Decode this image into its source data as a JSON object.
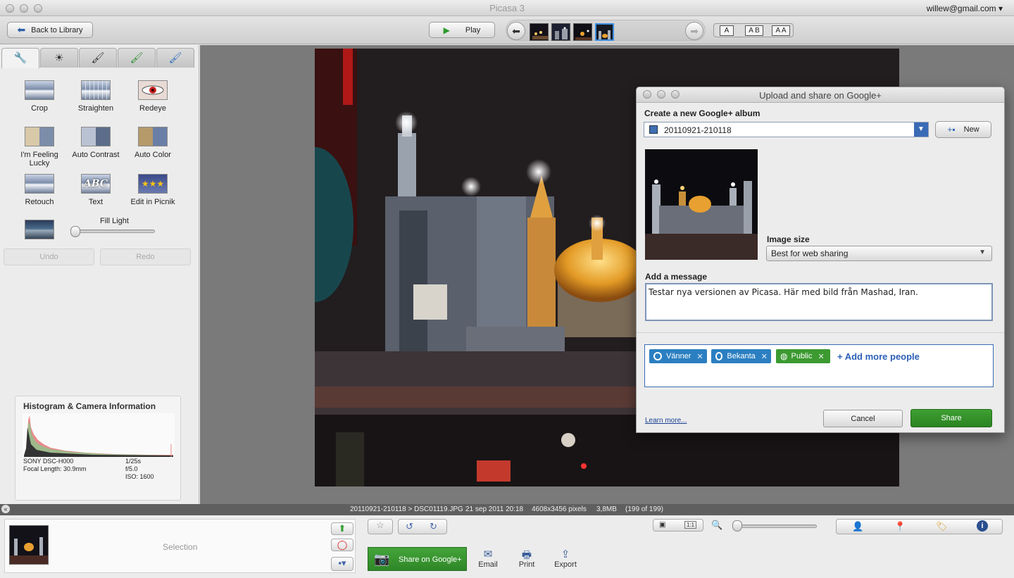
{
  "window": {
    "title": "Picasa 3",
    "account": "willew@gmail.com"
  },
  "toolbar": {
    "back_label": "Back to Library",
    "play_label": "Play",
    "captions": [
      "A",
      "A B",
      "A A"
    ]
  },
  "edit_panel": {
    "tools": [
      {
        "label": "Crop"
      },
      {
        "label": "Straighten"
      },
      {
        "label": "Redeye"
      },
      {
        "label": "I'm Feeling Lucky"
      },
      {
        "label": "Auto Contrast"
      },
      {
        "label": "Auto Color"
      },
      {
        "label": "Retouch"
      },
      {
        "label": "Text"
      },
      {
        "label": "Edit in Picnik"
      }
    ],
    "fill_light_label": "Fill Light",
    "fill_light_value": 0,
    "undo_label": "Undo",
    "redo_label": "Redo"
  },
  "histogram": {
    "title": "Histogram & Camera Information",
    "camera": "SONY DSC-H000",
    "focal_length": "Focal Length: 30.9mm",
    "shutter": "1/25s",
    "aperture": "f/5.0",
    "iso": "ISO: 1600"
  },
  "dialog": {
    "title": "Upload and share on Google+",
    "album_heading": "Create a new Google+ album",
    "album_name": "20110921-210118",
    "new_label": "New",
    "image_size_label": "Image size",
    "image_size_value": "Best for web sharing",
    "message_label": "Add a message",
    "message_value": "Testar nya versionen av Picasa. Här med bild från Mashad, Iran.",
    "circles": [
      {
        "name": "Vänner",
        "color": "#2b7fc1"
      },
      {
        "name": "Bekanta",
        "color": "#2b7fc1"
      },
      {
        "name": "Public",
        "color": "#3c9a31"
      }
    ],
    "add_people_label": "+ Add more people",
    "learn_more": "Learn more...",
    "cancel_label": "Cancel",
    "share_label": "Share"
  },
  "infobar": {
    "path": "20110921-210118 > DSC01119.JPG",
    "date": "21 sep 2011 20:18",
    "dimensions": "4608x3456 pixels",
    "size": "3,8MB",
    "position": "(199 of 199)"
  },
  "bottom": {
    "selection_label": "Selection",
    "share_gplus_label": "Share on Google+",
    "actions": [
      {
        "label": "Email",
        "icon": "envelope-icon"
      },
      {
        "label": "Print",
        "icon": "printer-icon"
      },
      {
        "label": "Export",
        "icon": "export-icon"
      }
    ],
    "zoom_fit_label": "1:1"
  }
}
